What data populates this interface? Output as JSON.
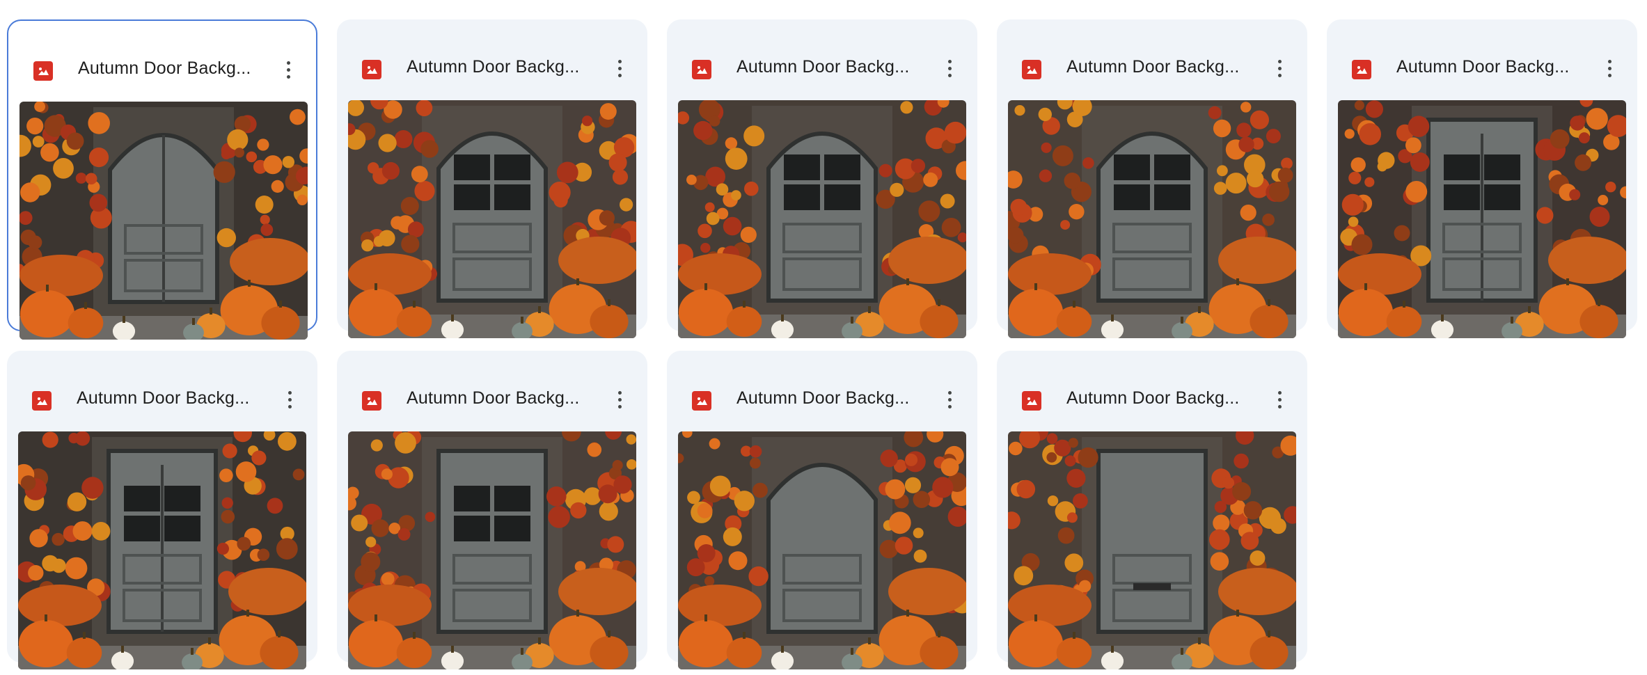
{
  "files": [
    {
      "name": "Autumn Door Backg...",
      "selected": true,
      "variant": "double-arch-lanterns"
    },
    {
      "name": "Autumn Door Backg...",
      "selected": false,
      "variant": "arched-glass"
    },
    {
      "name": "Autumn Door Backg...",
      "selected": false,
      "variant": "arched-glass"
    },
    {
      "name": "Autumn Door Backg...",
      "selected": false,
      "variant": "arched-glass"
    },
    {
      "name": "Autumn Door Backg...",
      "selected": false,
      "variant": "double-glass"
    },
    {
      "name": "Autumn Door Backg...",
      "selected": false,
      "variant": "double-glass-lamps"
    },
    {
      "name": "Autumn Door Backg...",
      "selected": false,
      "variant": "square-glass"
    },
    {
      "name": "Autumn Door Backg...",
      "selected": false,
      "variant": "arched-panel"
    },
    {
      "name": "Autumn Door Backg...",
      "selected": false,
      "variant": "mail-slot"
    }
  ],
  "colors": {
    "accent": "#4a7bd8",
    "file_icon": "#d93025",
    "card_bg": "#f0f4f9"
  },
  "icons": {
    "file_type": "image-icon",
    "more": "more-vertical-icon"
  }
}
